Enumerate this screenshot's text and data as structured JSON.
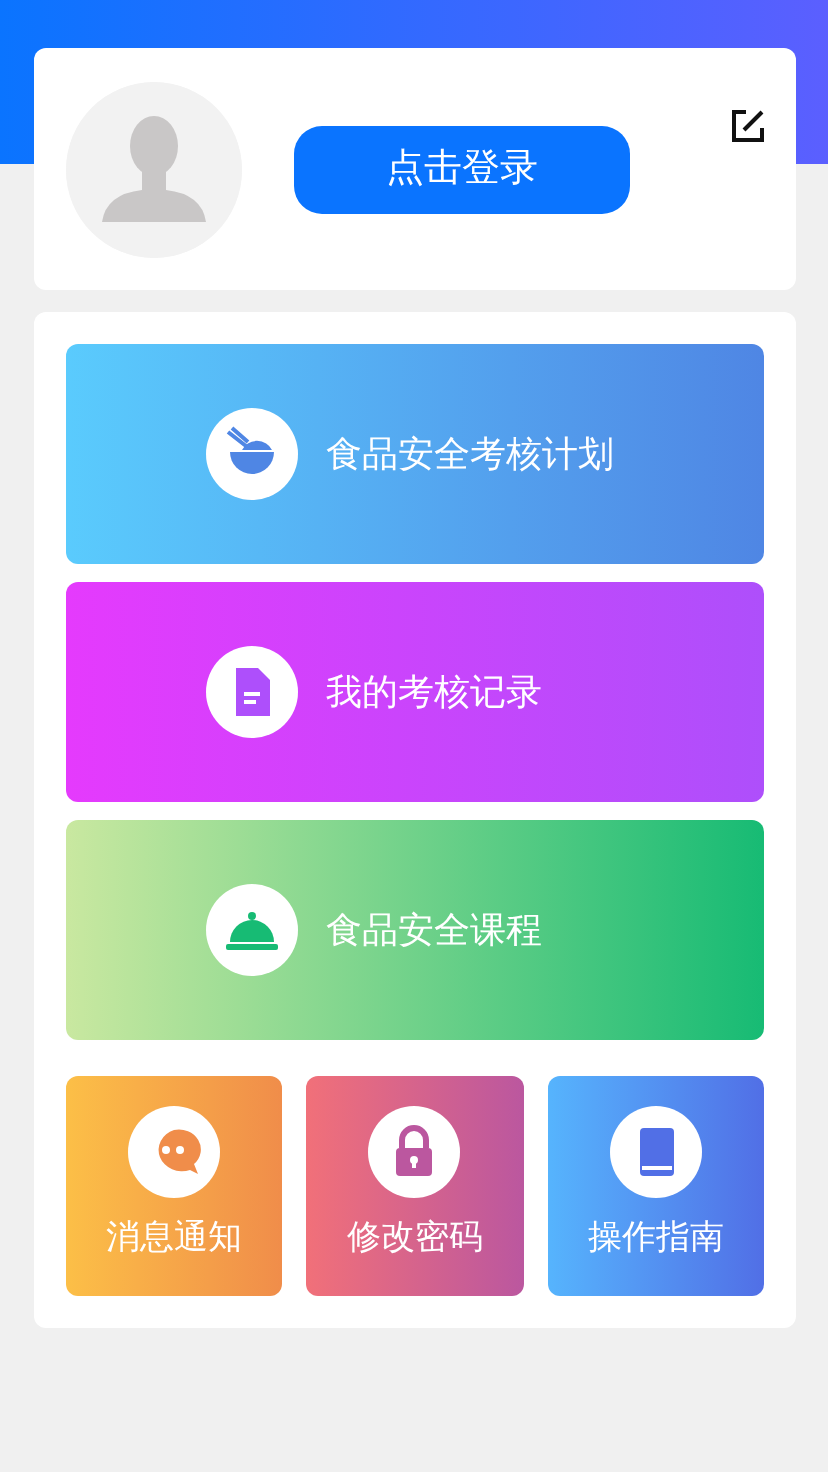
{
  "profile": {
    "login_button": "点击登录"
  },
  "main_tiles": [
    {
      "label": "食品安全考核计划",
      "kind": "bowl",
      "color": "#5acbfd"
    },
    {
      "label": "我的考核记录",
      "kind": "document",
      "color": "#e53afd"
    },
    {
      "label": "食品安全课程",
      "kind": "cloche",
      "color": "#c9e8a0"
    }
  ],
  "small_tiles": [
    {
      "label": "消息通知",
      "kind": "chat",
      "color": "#fcbf47"
    },
    {
      "label": "修改密码",
      "kind": "lock",
      "color": "#f17079"
    },
    {
      "label": "操作指南",
      "kind": "book",
      "color": "#56b4fd"
    }
  ]
}
